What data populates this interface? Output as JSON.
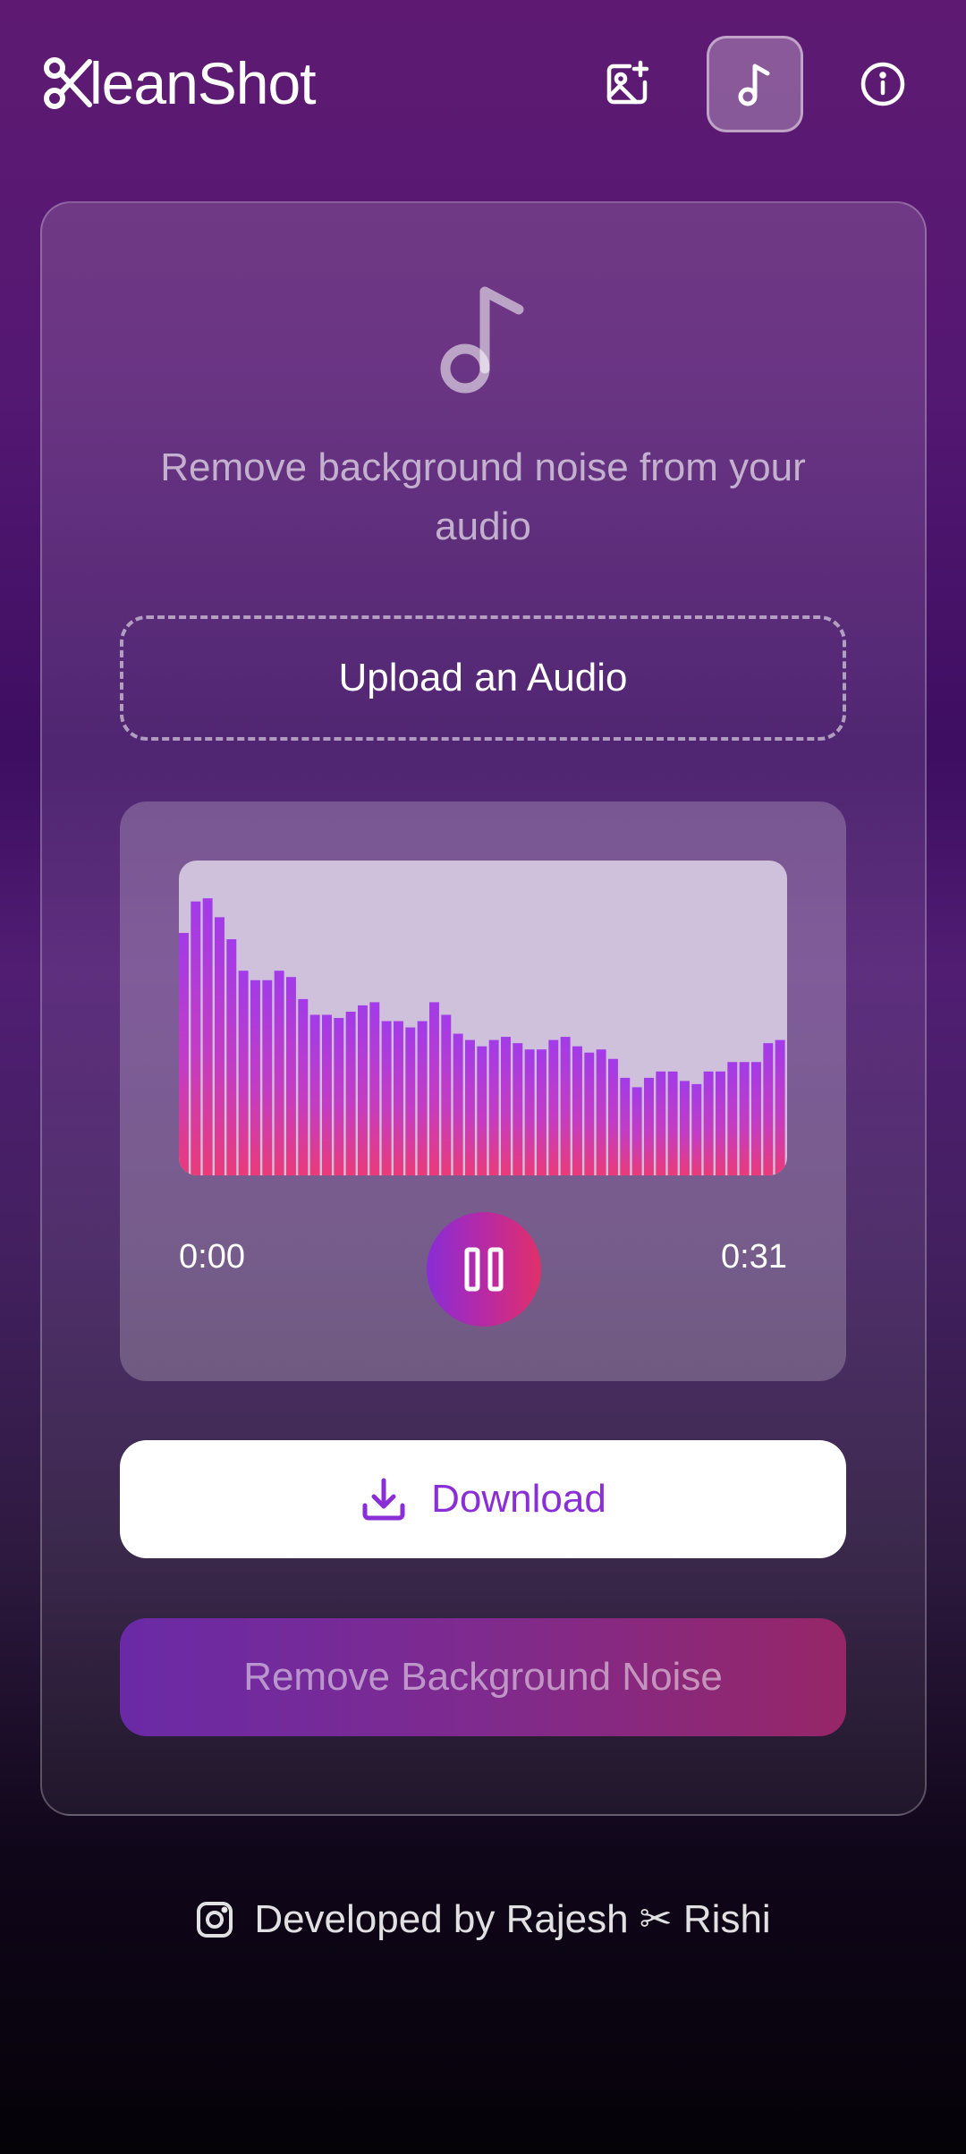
{
  "app": {
    "name": "XleanShot",
    "name_suffix": "leanShot"
  },
  "header": {
    "image_tool_icon": "image-plus-icon",
    "audio_tool_icon": "music-note-icon",
    "info_icon": "info-icon"
  },
  "main": {
    "hero_icon": "music-note-icon",
    "subtitle": "Remove background noise from your audio",
    "upload_label": "Upload an Audio"
  },
  "player": {
    "current_time": "0:00",
    "duration": "0:31",
    "state_icon": "pause-icon",
    "waveform_levels": [
      0.77,
      0.87,
      0.88,
      0.82,
      0.75,
      0.65,
      0.62,
      0.62,
      0.65,
      0.63,
      0.56,
      0.51,
      0.51,
      0.5,
      0.52,
      0.54,
      0.55,
      0.49,
      0.49,
      0.47,
      0.49,
      0.55,
      0.51,
      0.45,
      0.43,
      0.41,
      0.43,
      0.44,
      0.42,
      0.4,
      0.4,
      0.43,
      0.44,
      0.41,
      0.39,
      0.4,
      0.37,
      0.31,
      0.28,
      0.31,
      0.33,
      0.33,
      0.3,
      0.29,
      0.33,
      0.33,
      0.36,
      0.36,
      0.36,
      0.42,
      0.43
    ]
  },
  "actions": {
    "download_label": "Download",
    "download_icon": "download-icon",
    "remove_label": "Remove Background Noise"
  },
  "footer": {
    "text": "Developed by Rajesh ✂ Rishi",
    "icon": "instagram-icon"
  },
  "colors": {
    "accent": "#8a2fd8",
    "wave_top": "#a23be8",
    "wave_bottom": "#ea3b7a",
    "wave_bg": "#cfc0dc"
  }
}
